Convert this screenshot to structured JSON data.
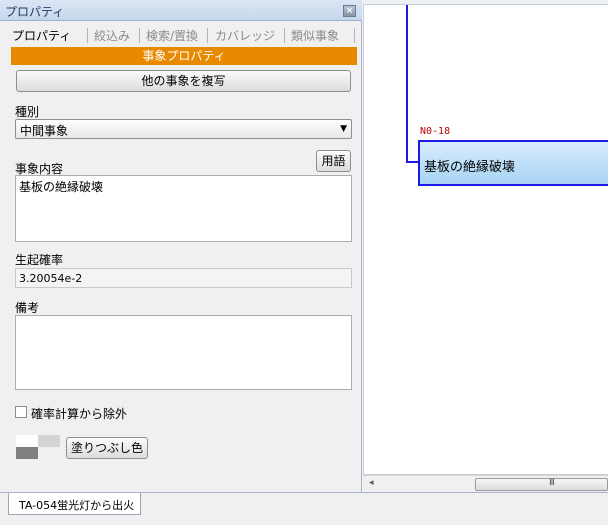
{
  "panel": {
    "title": "プロパティ",
    "close_glyph": "×",
    "tabs": [
      {
        "label": "プロパティ"
      },
      {
        "label": "絞込み"
      },
      {
        "label": "検索/置換"
      },
      {
        "label": "カバレッジ"
      },
      {
        "label": "類似事象"
      }
    ],
    "section_header": "事象プロパティ",
    "copy_button": "他の事象を複写",
    "type_label": "種別",
    "type_value": "中間事象",
    "content_label": "事象内容",
    "term_button": "用語",
    "content_value": "基板の絶縁破壊",
    "probability_label": "生起確率",
    "probability_value": "3.20054e-2",
    "notes_label": "備考",
    "notes_value": "",
    "exclude_checkbox_label": "確率計算から除外",
    "exclude_checked": false,
    "fill_color_button": "塗りつぶし色",
    "fill_swatch_colors": [
      "#ffffff",
      "#d4d4d4",
      "#7f7f7f"
    ]
  },
  "status": {
    "tab_label": "TA-054蛍光灯から出火"
  },
  "diagram": {
    "node_id": "N0-18",
    "node_text": "基板の絶縁破壊",
    "line_color": "#1a1ae6",
    "id_color": "#c00000"
  },
  "scrollbar": {
    "left_arrow": "◂",
    "grip": "III"
  }
}
